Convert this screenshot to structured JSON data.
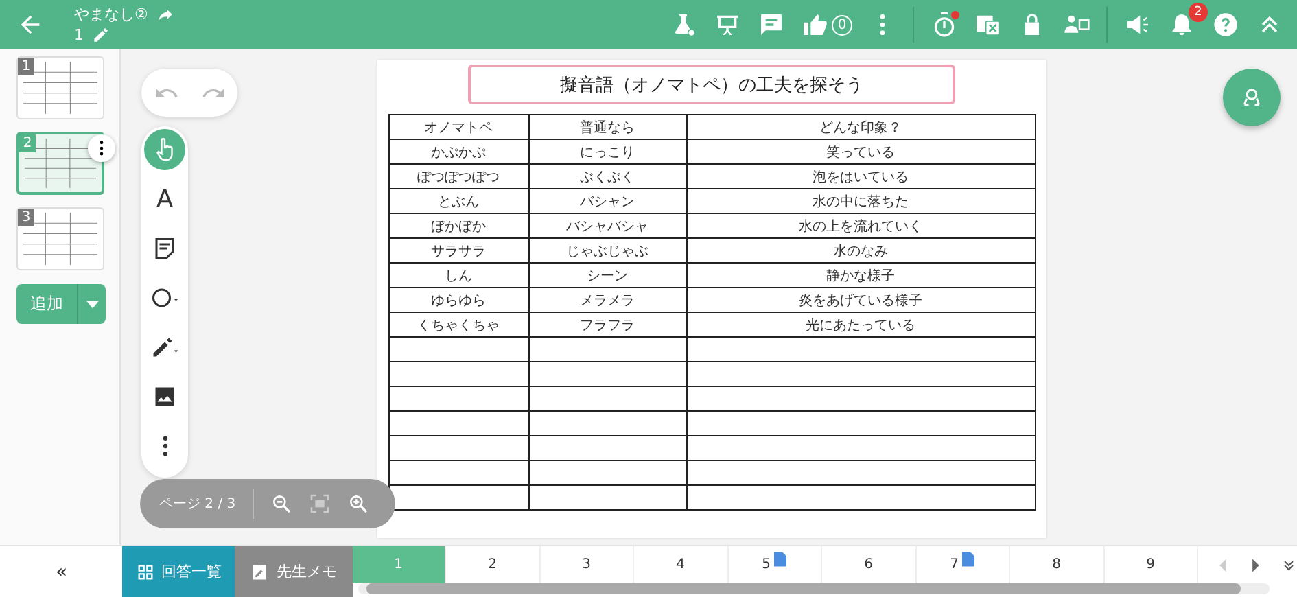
{
  "header": {
    "title": "やまなし②",
    "page_number": "1",
    "like_count": "0",
    "timer_alert": true,
    "notification_count": "2"
  },
  "sidebar": {
    "thumbnails": [
      {
        "number": "1",
        "selected": false
      },
      {
        "number": "2",
        "selected": true
      },
      {
        "number": "3",
        "selected": false
      }
    ],
    "add_button": "追加"
  },
  "tools": [
    {
      "kind": "pointer",
      "selected": true
    },
    {
      "kind": "text",
      "selected": false,
      "label": "A"
    },
    {
      "kind": "note",
      "selected": false
    },
    {
      "kind": "shape",
      "selected": false
    },
    {
      "kind": "pen",
      "selected": false
    },
    {
      "kind": "image",
      "selected": false
    },
    {
      "kind": "more",
      "selected": false
    }
  ],
  "page_indicator": "ページ 2 / 3",
  "worksheet": {
    "title": "擬音語（オノマトペ）の工夫を探そう",
    "columns": [
      "オノマトペ",
      "普通なら",
      "どんな印象？"
    ],
    "rows": [
      [
        "かぷかぷ",
        "にっこり",
        "笑っている"
      ],
      [
        "ぽつぽつぽつ",
        "ぶくぶく",
        "泡をはいている"
      ],
      [
        "とぶん",
        "バシャン",
        "水の中に落ちた"
      ],
      [
        "ぼかぼか",
        "バシャバシャ",
        "水の上を流れていく"
      ],
      [
        "サラサラ",
        "じゃぶじゃぶ",
        "水のなみ"
      ],
      [
        "しん",
        "シーン",
        "静かな様子"
      ],
      [
        "ゆらゆら",
        "メラメラ",
        "炎をあげている様子"
      ],
      [
        "くちゃくちゃ",
        "フラフラ",
        "光にあたっている"
      ]
    ]
  },
  "bottom_bar": {
    "collapse": "«",
    "answers_button": "回答一覧",
    "memo_button": "先生メモ",
    "pages": [
      {
        "label": "1",
        "selected": true,
        "has_file": false
      },
      {
        "label": "2",
        "selected": false,
        "has_file": false
      },
      {
        "label": "3",
        "selected": false,
        "has_file": false
      },
      {
        "label": "4",
        "selected": false,
        "has_file": false
      },
      {
        "label": "5",
        "selected": false,
        "has_file": true
      },
      {
        "label": "6",
        "selected": false,
        "has_file": false
      },
      {
        "label": "7",
        "selected": false,
        "has_file": true
      },
      {
        "label": "8",
        "selected": false,
        "has_file": false
      },
      {
        "label": "9",
        "selected": false,
        "has_file": false
      }
    ]
  }
}
